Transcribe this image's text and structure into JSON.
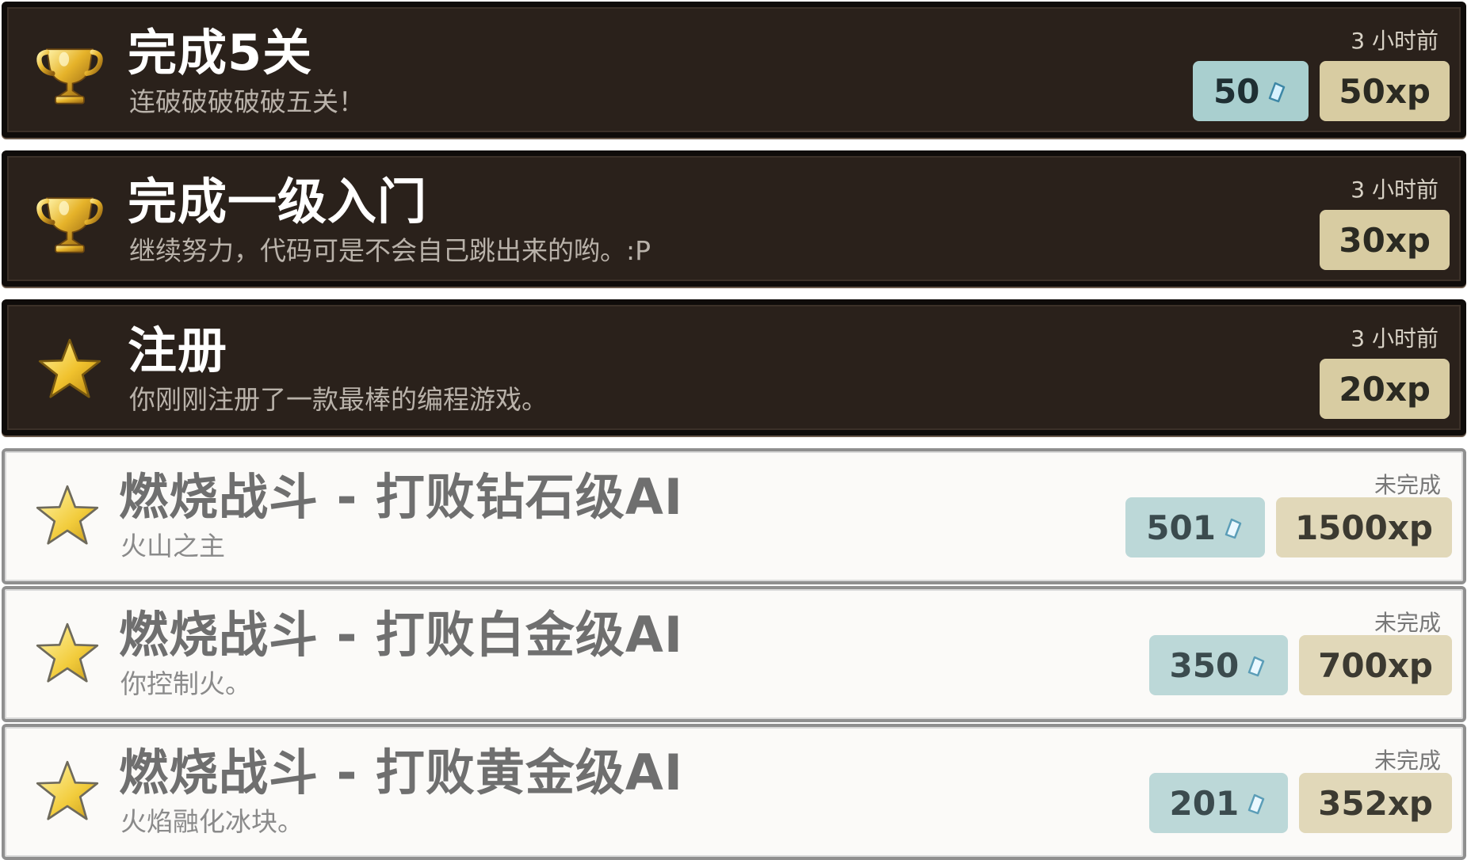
{
  "achievements": [
    {
      "state": "done",
      "icon": "trophy-icon",
      "title": "完成5关",
      "description": "连破破破破破五关！",
      "time": "3 小时前",
      "gems": "50",
      "xp": "50xp"
    },
    {
      "state": "done",
      "icon": "trophy-icon",
      "title": "完成一级入门",
      "description": "继续努力，代码可是不会自己跳出来的哟。:P",
      "time": "3 小时前",
      "gems": null,
      "xp": "30xp"
    },
    {
      "state": "done",
      "icon": "star-icon",
      "title": "注册",
      "description": "你刚刚注册了一款最棒的编程游戏。",
      "time": "3 小时前",
      "gems": null,
      "xp": "20xp"
    },
    {
      "state": "todo",
      "icon": "star-icon",
      "title": "燃烧战斗 - 打败钻石级AI",
      "description": "火山之主",
      "time": "未完成",
      "gems": "501",
      "xp": "1500xp"
    },
    {
      "state": "todo",
      "icon": "star-icon",
      "title": "燃烧战斗 - 打败白金级AI",
      "description": "你控制火。",
      "time": "未完成",
      "gems": "350",
      "xp": "700xp"
    },
    {
      "state": "todo",
      "icon": "star-icon",
      "title": "燃烧战斗 - 打败黄金级AI",
      "description": "火焰融化冰块。",
      "time": "未完成",
      "gems": "201",
      "xp": "352xp"
    }
  ],
  "colors": {
    "done_bg": "#2a211b",
    "todo_bg": "#fbfaf8",
    "gem_badge": "#a9cfcf",
    "xp_badge": "#d8cca2",
    "gold": "#e9b627"
  }
}
